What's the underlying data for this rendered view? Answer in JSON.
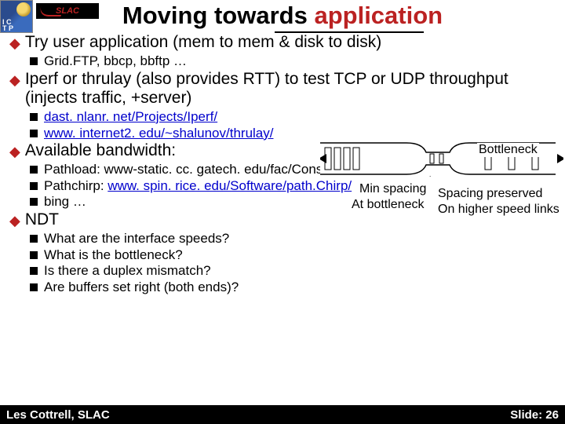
{
  "logos": {
    "ictp": "ICTP",
    "slac": "SLAC"
  },
  "title": {
    "part1": "Moving towards",
    "part2": "application"
  },
  "bullets": {
    "b1": "Try user application (mem to mem & disk to disk)",
    "b1a": "Grid.FTP, bbcp, bbftp …",
    "b2": "Iperf or thrulay (also provides RTT) to test TCP or UDP throughput (injects traffic, +server)",
    "b2a": "dast. nlanr. net/Projects/Iperf/",
    "b2b": "www. internet2. edu/~shalunov/thrulay/",
    "b3": "Available bandwidth:",
    "b3a_pre": "Pathload: www-static. cc. gatech. edu/fac/Constantinos. Dovrolis/pathload. html",
    "b3b_pre": "Pathchirp: ",
    "b3b_link": "www. spin. rice. edu/Software/path.Chirp/",
    "b3c": "bing …",
    "b4": "NDT",
    "b4a": "What are the interface speeds?",
    "b4b": "What is the bottleneck?",
    "b4c": "Is there a duplex mismatch?",
    "b4d": "Are buffers set right (both ends)?"
  },
  "diagram": {
    "bottleneck": "Bottleneck",
    "min_spacing": "Min spacing",
    "at_bottleneck": "At bottleneck",
    "spacing_preserved": "Spacing preserved",
    "on_higher": "On higher speed links"
  },
  "footer": {
    "left": "Les Cottrell, SLAC",
    "right": "Slide: 26"
  }
}
